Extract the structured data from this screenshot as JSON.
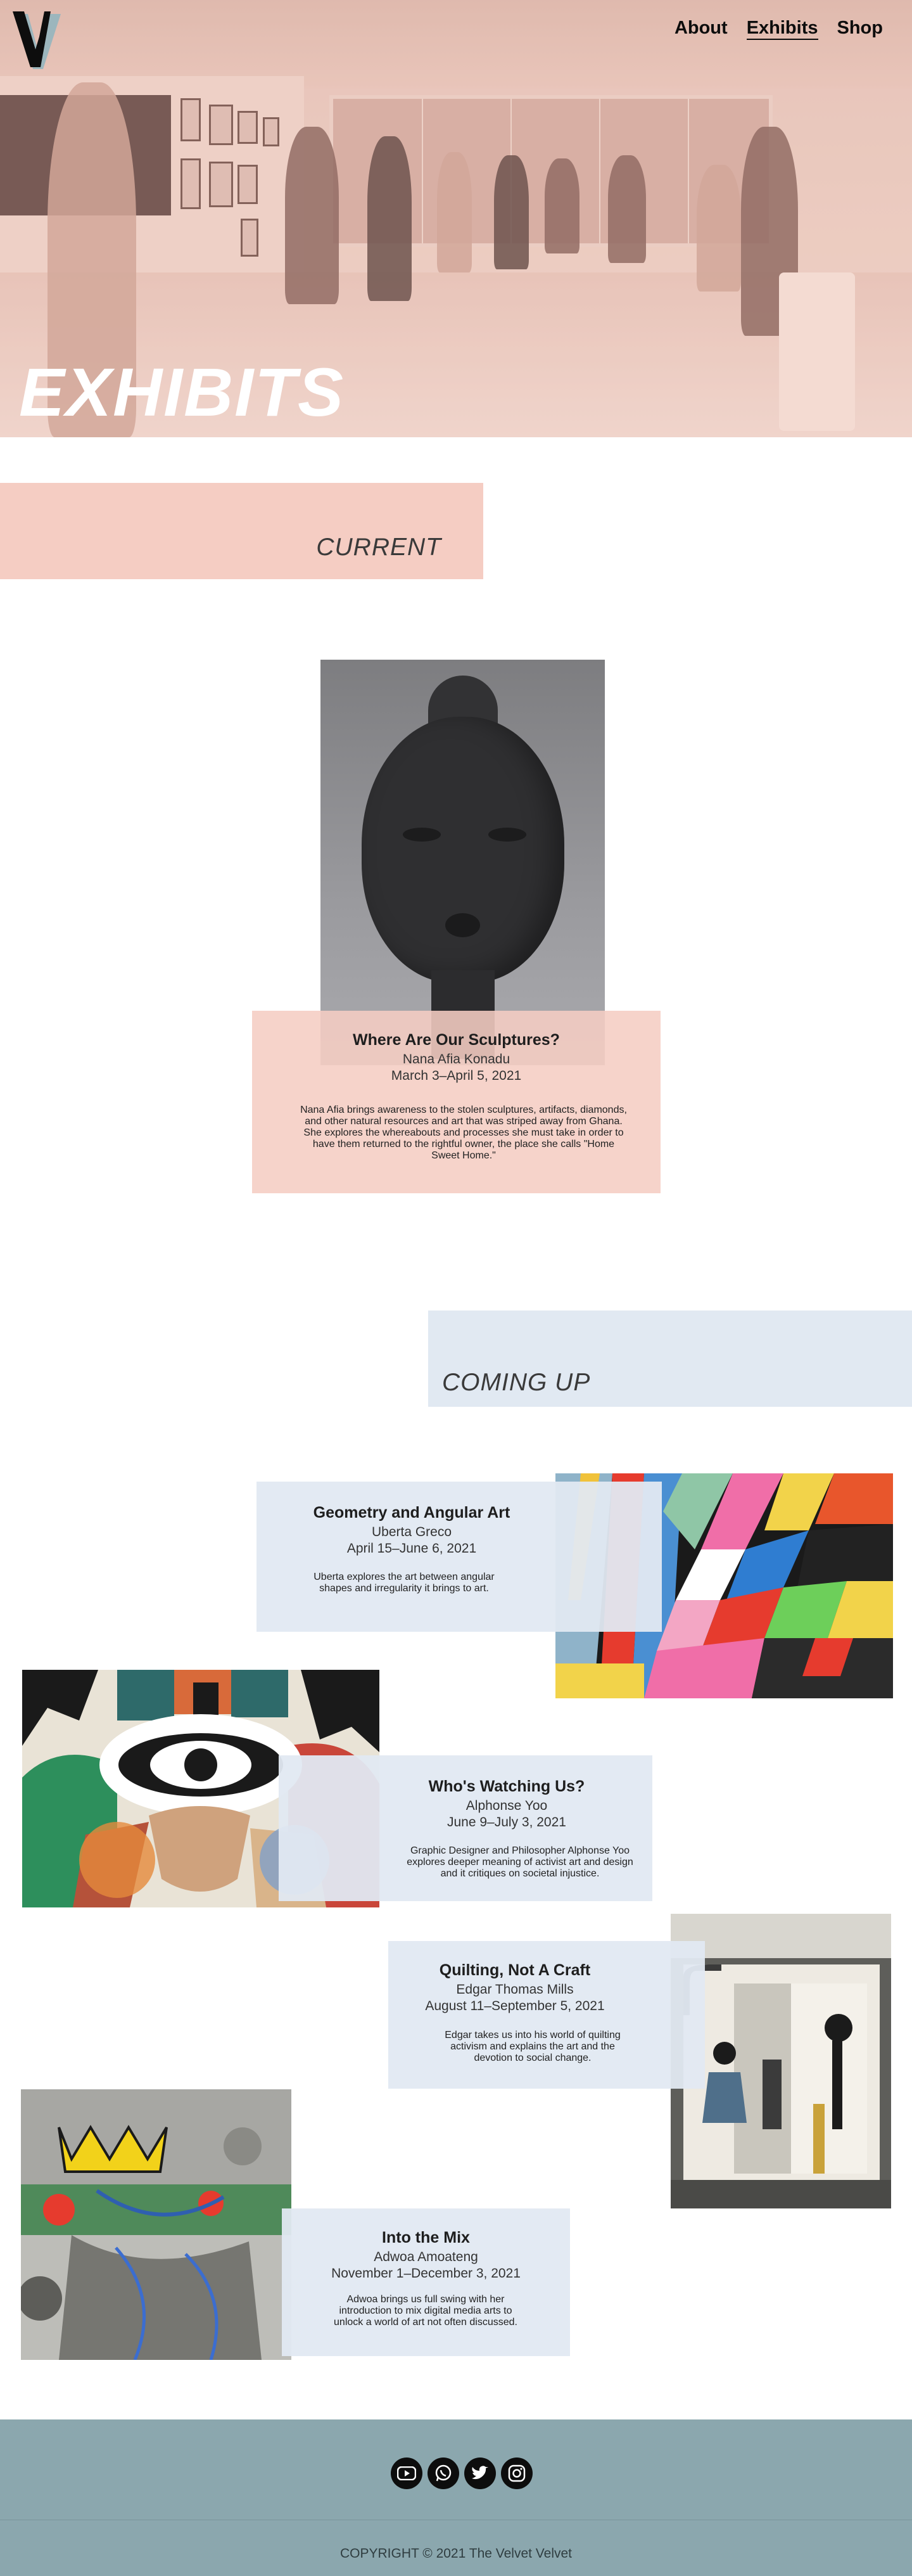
{
  "brand": {
    "logo_letter": "V"
  },
  "nav": {
    "items": [
      {
        "label": "About"
      },
      {
        "label": "Exhibits"
      },
      {
        "label": "Shop"
      }
    ],
    "active": "Exhibits"
  },
  "hero": {
    "title": "EXHIBITS"
  },
  "sections": {
    "current_label": "CURRENT",
    "coming_label": "COMING UP"
  },
  "current": {
    "title": "Where Are Our Sculptures?",
    "artist": "Nana Afia Konadu",
    "dates": "March 3–April 5, 2021",
    "description": "Nana Afia brings awareness to the stolen sculptures, artifacts, diamonds, and other natural resources and art that was striped away from Ghana. She explores the whereabouts and processes she must take in order to have them returned to the rightful owner, the place she calls \"Home Sweet Home.\""
  },
  "upcoming": [
    {
      "title": "Geometry and Angular Art",
      "artist": "Uberta Greco",
      "dates": "April 15–June 6, 2021",
      "description": "Uberta explores the art between angular shapes and irregularity it brings to art."
    },
    {
      "title": "Who's Watching Us?",
      "artist": "Alphonse Yoo",
      "dates": "June 9–July 3, 2021",
      "description": "Graphic Designer and Philosopher Alphonse Yoo explores deeper meaning of activist art and design and it critiques on societal injustice."
    },
    {
      "title": "Quilting, Not A Craft",
      "artist": "Edgar Thomas Mills",
      "dates": "August 11–September 5, 2021",
      "description": "Edgar takes us into his world of quilting activism and explains the art and the devotion to social change."
    },
    {
      "title": "Into the Mix",
      "artist": "Adwoa Amoateng",
      "dates": "November 1–December 3, 2021",
      "description": "Adwoa brings us full swing with her introduction to mix digital media arts to unlock a world of art not often discussed."
    }
  ],
  "social": [
    {
      "icon": "youtube-icon"
    },
    {
      "icon": "whatsapp-icon"
    },
    {
      "icon": "twitter-icon"
    },
    {
      "icon": "instagram-icon"
    }
  ],
  "footer": {
    "copyright": "COPYRIGHT © 2021 The Velvet Velvet"
  },
  "colors": {
    "pink_accent": "#f5cdc3",
    "blue_accent": "#e1e9f2",
    "footer_bg": "#8ba7ae"
  }
}
